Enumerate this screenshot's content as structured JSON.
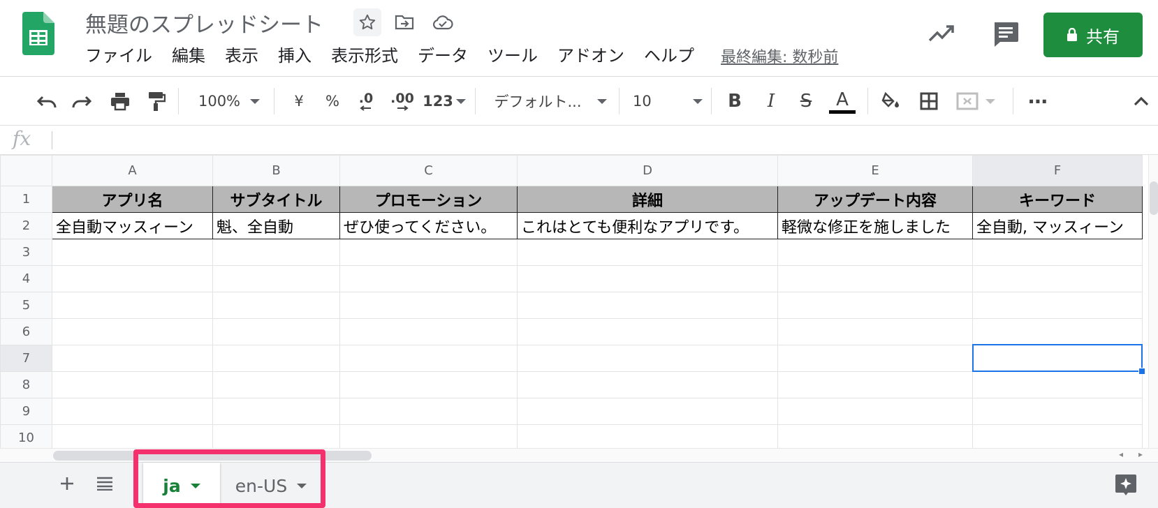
{
  "app": {
    "doc_title": "無題のスプレッドシート",
    "share_label": "共有",
    "last_edit": "最終編集: 数秒前",
    "accent": "#1e8e3e"
  },
  "menu": [
    "ファイル",
    "編集",
    "表示",
    "挿入",
    "表示形式",
    "データ",
    "ツール",
    "アドオン",
    "ヘルプ"
  ],
  "toolbar": {
    "zoom": "100%",
    "currency": "¥",
    "percent": "%",
    "decimal_decrease": ".0",
    "decimal_increase": ".00",
    "more_formats": "123",
    "font": "デフォルト...",
    "font_size": "10",
    "bold": "B",
    "italic": "I",
    "strikethrough": "S",
    "text_color": "A",
    "more": "⋯"
  },
  "formula": {
    "fx": "fx",
    "value": ""
  },
  "grid": {
    "columns": [
      "A",
      "B",
      "C",
      "D",
      "E",
      "F"
    ],
    "rows": [
      "1",
      "2",
      "3",
      "4",
      "5",
      "6",
      "7",
      "8",
      "9",
      "10"
    ],
    "header_row": [
      "アプリ名",
      "サブタイトル",
      "プロモーション",
      "詳細",
      "アップデート内容",
      "キーワード"
    ],
    "data_row": [
      "全自動マッスィーン",
      "魁、全自動",
      "ぜひ使ってください。",
      "これはとても便利なアプリです。",
      "軽微な修正を施しました",
      "全自動, マッスィーン"
    ],
    "selected_cell": "F7",
    "header_fill": "#b7b7b7",
    "selection_color": "#1a73e8"
  },
  "sheets": {
    "tabs": [
      {
        "label": "ja",
        "active": true
      },
      {
        "label": "en-US",
        "active": false
      }
    ],
    "highlight_color": "#f4306d",
    "active_color": "#188038"
  }
}
